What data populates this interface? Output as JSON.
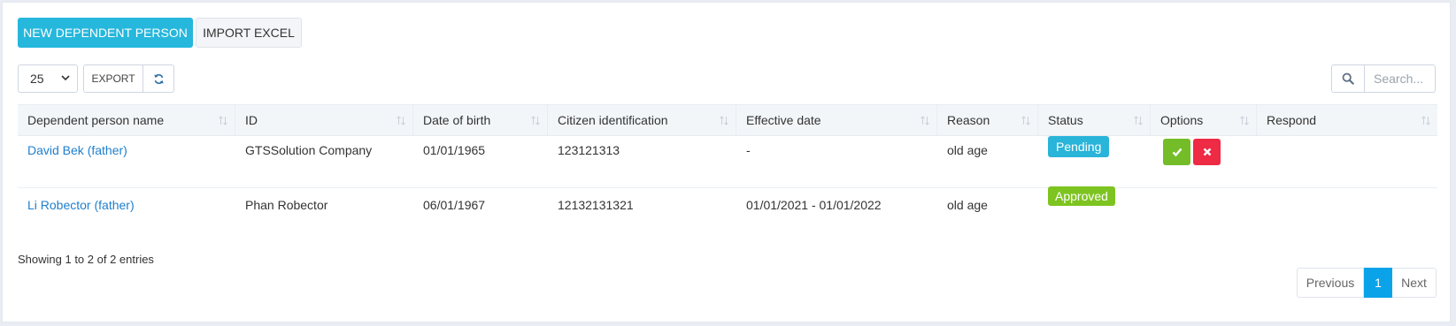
{
  "toolbar": {
    "new_label": "NEW DEPENDENT PERSON",
    "import_label": "IMPORT EXCEL",
    "page_size": "25",
    "export_label": "EXPORT",
    "search_placeholder": "Search..."
  },
  "table": {
    "columns": [
      "Dependent person name",
      "ID",
      "Date of birth",
      "Citizen identification",
      "Effective date",
      "Reason",
      "Status",
      "Options",
      "Respond"
    ],
    "rows": [
      {
        "name": "David Bek (father)",
        "id": "GTSSolution Company",
        "dob": "01/01/1965",
        "citizen_id": "123121313",
        "effective": "-",
        "reason": "old age",
        "status": "Pending",
        "respond": ""
      },
      {
        "name": "Li Robector (father)",
        "id": "Phan Robector",
        "dob": "06/01/1967",
        "citizen_id": "12132131321",
        "effective": "01/01/2021 - 01/01/2022",
        "reason": "old age",
        "status": "Approved",
        "respond": ""
      }
    ]
  },
  "footer": {
    "info": "Showing 1 to 2 of 2 entries",
    "previous": "Previous",
    "current_page": "1",
    "next": "Next"
  },
  "colors": {
    "primary": "#26b7dc",
    "pending": "#29b4d9",
    "approved": "#7ec421",
    "approve_button": "#74bd28",
    "reject_button": "#ee2a45",
    "link": "#1f7fcd",
    "page_active": "#0aa3e9"
  },
  "icons": {
    "refresh": "refresh-icon",
    "search": "search-icon",
    "approve": "check-icon",
    "reject": "close-icon",
    "sort": "sort-icon"
  }
}
